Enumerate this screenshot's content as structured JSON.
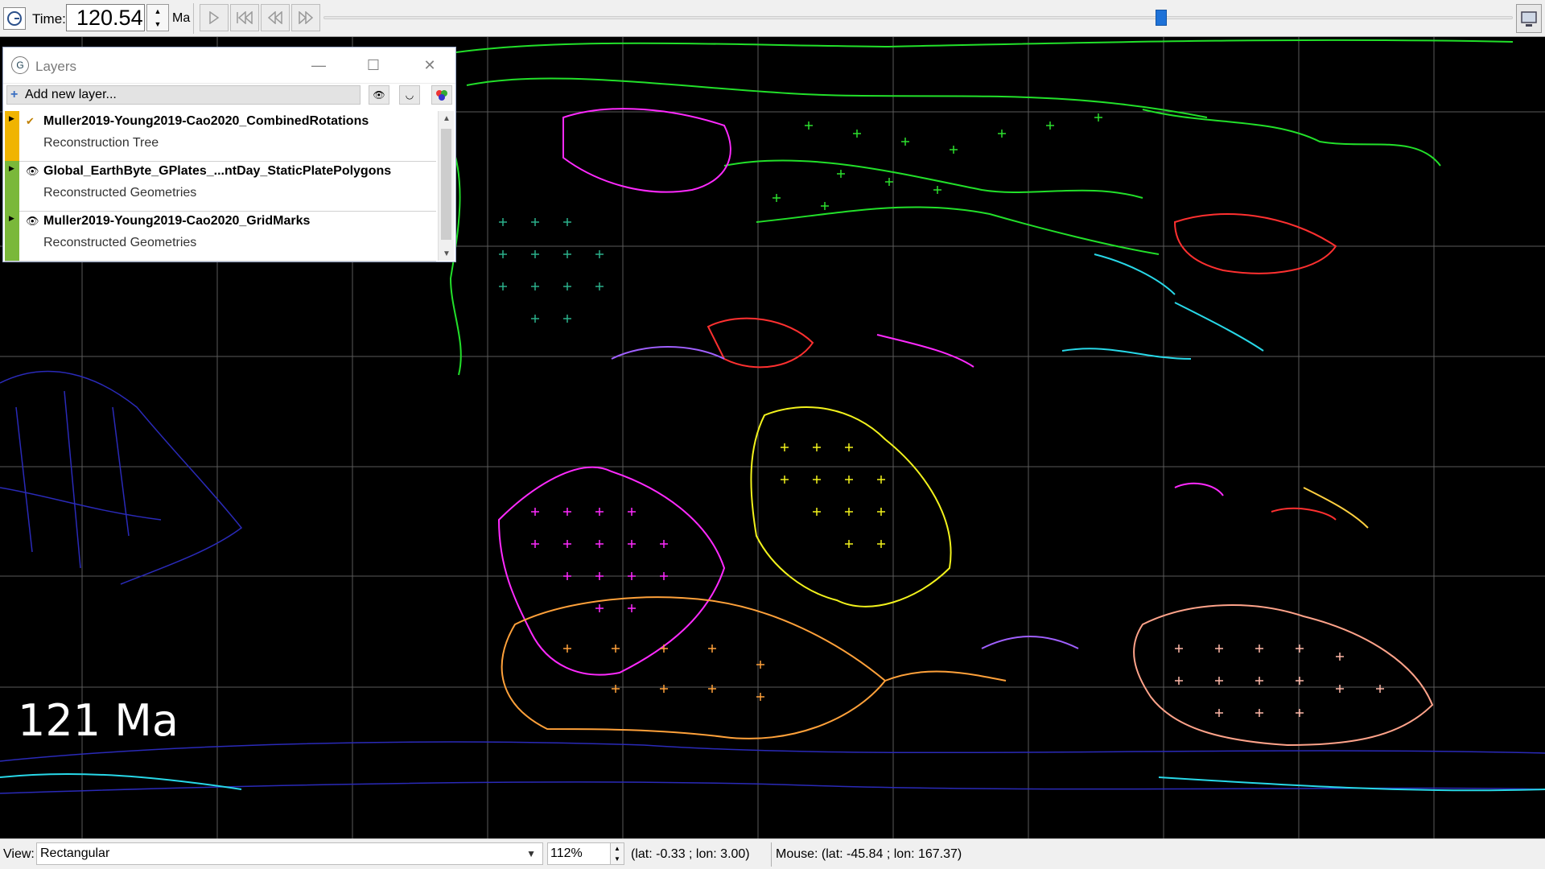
{
  "toolbar": {
    "time_label": "Time:",
    "time_value": "120.54",
    "time_unit": "Ma",
    "play_icon": "play-icon",
    "rewind_icon": "skip-to-start-icon",
    "step_back_icon": "step-back-icon",
    "step_forward_icon": "step-forward-icon"
  },
  "map": {
    "age_label": "121 Ma",
    "background": "#000000"
  },
  "layers_window": {
    "title": "Layers",
    "add_layer_label": "Add new layer...",
    "layers": [
      {
        "name": "Muller2019-Young2019-Cao2020_CombinedRotations",
        "type": "Reconstruction Tree",
        "stripe_color": "#f0b400",
        "checked": true
      },
      {
        "name": "Global_EarthByte_GPlates_...ntDay_StaticPlatePolygons",
        "type": "Reconstructed Geometries",
        "stripe_color": "#7ab83a",
        "checked": false
      },
      {
        "name": "Muller2019-Young2019-Cao2020_GridMarks",
        "type": "Reconstructed Geometries",
        "stripe_color": "#7ab83a",
        "checked": false
      }
    ]
  },
  "statusbar": {
    "view_label": "View:",
    "view_value": "Rectangular",
    "zoom_value": "112%",
    "camera_coords": "(lat: -0.33 ; lon: 3.00)",
    "mouse_coords": "Mouse: (lat: -45.84 ; lon: 167.37)"
  }
}
